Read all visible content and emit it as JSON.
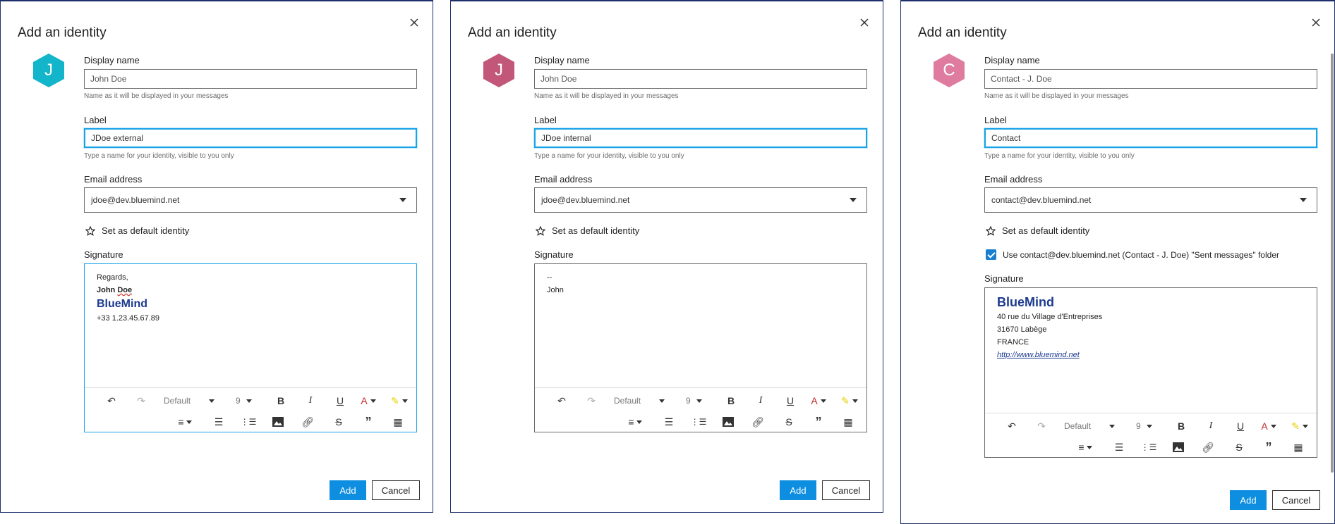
{
  "dialogs": [
    {
      "title": "Add an identity",
      "avatar_letter": "J",
      "avatar_color": "#12b5c9",
      "display_name_label": "Display name",
      "display_name_value": "John Doe",
      "display_name_hint": "Name as it will be displayed in your messages",
      "label_label": "Label",
      "label_value": "JDoe external",
      "label_hint": "Type a name for your identity, visible to you only",
      "email_label": "Email address",
      "email_value": "jdoe@dev.bluemind.net",
      "default_identity": "Set as default identity",
      "signature_label": "Signature",
      "signature": {
        "line1": "Regards,",
        "line2_a": "John ",
        "line2_b": "Doe",
        "brand": "BlueMind",
        "phone": "+33 1.23.45.67.89"
      },
      "font_name": "Default",
      "font_size": "9",
      "add": "Add",
      "cancel": "Cancel"
    },
    {
      "title": "Add an identity",
      "avatar_letter": "J",
      "avatar_color": "#c2577a",
      "display_name_label": "Display name",
      "display_name_value": "John Doe",
      "display_name_hint": "Name as it will be displayed in your messages",
      "label_label": "Label",
      "label_value": "JDoe internal",
      "label_hint": "Type a name for your identity, visible to you only",
      "email_label": "Email address",
      "email_value": "jdoe@dev.bluemind.net",
      "default_identity": "Set as default identity",
      "signature_label": "Signature",
      "signature": {
        "line1": "--",
        "line2": "John"
      },
      "font_name": "Default",
      "font_size": "9",
      "add": "Add",
      "cancel": "Cancel"
    },
    {
      "title": "Add an identity",
      "avatar_letter": "C",
      "avatar_color": "#e07ba0",
      "display_name_label": "Display name",
      "display_name_value": "Contact - J. Doe",
      "display_name_hint": "Name as it will be displayed in your messages",
      "label_label": "Label",
      "label_value": "Contact",
      "label_hint": "Type a name for your identity, visible to you only",
      "email_label": "Email address",
      "email_value": "contact@dev.bluemind.net",
      "default_identity": "Set as default identity",
      "sent_folder": "Use contact@dev.bluemind.net (Contact - J. Doe) \"Sent messages\" folder",
      "signature_label": "Signature",
      "signature": {
        "brand": "BlueMind",
        "addr1": "40 rue du Village d'Entreprises",
        "addr2": "31670 Labège",
        "addr3": "FRANCE",
        "url": "http://www.bluemind.net"
      },
      "font_name": "Default",
      "font_size": "9",
      "add": "Add",
      "cancel": "Cancel"
    }
  ]
}
